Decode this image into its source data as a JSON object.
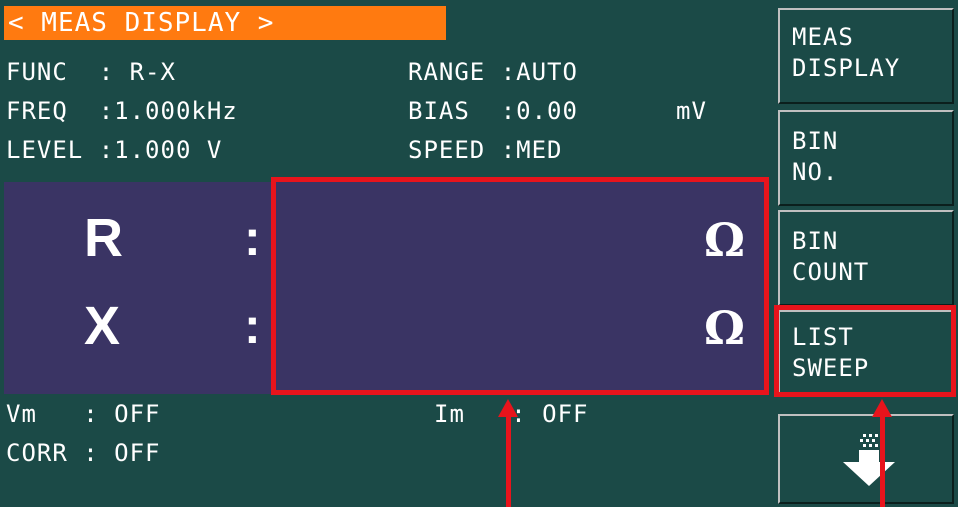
{
  "title": "< MEAS DISPLAY >",
  "settings": {
    "func": "FUNC  : R-X",
    "freq": "FREQ  :1.000kHz",
    "level": "LEVEL :1.000 V",
    "range": "RANGE :AUTO",
    "bias": "BIAS  :0.00",
    "bias_unit": "mV",
    "speed": "SPEED :MED"
  },
  "readings": {
    "primary_param": "R",
    "primary_colon": ":",
    "primary_unit": "Ω",
    "secondary_param": "X",
    "secondary_colon": ":",
    "secondary_unit": "Ω"
  },
  "status": {
    "vm": "Vm   : OFF",
    "im": "Im   : OFF",
    "corr": "CORR : OFF"
  },
  "softkeys": [
    {
      "label": "MEAS\nDISPLAY"
    },
    {
      "label": "BIN\nNO."
    },
    {
      "label": "BIN\nCOUNT"
    },
    {
      "label": "LIST\nSWEEP"
    }
  ],
  "icons": {
    "more": "page-down-arrow-icon"
  },
  "colors": {
    "lcd_background": "#1b4a47",
    "title_bar": "#ff7a10",
    "reading_band": "#3a3464",
    "annotation": "#e8141c"
  }
}
